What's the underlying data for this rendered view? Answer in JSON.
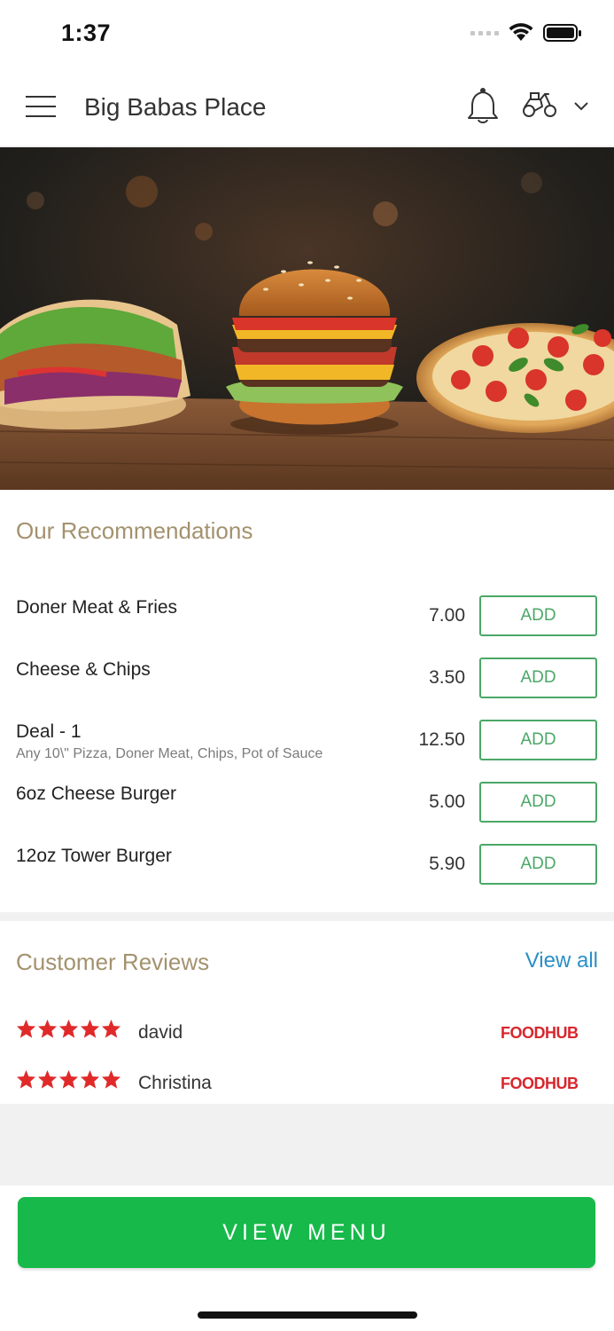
{
  "status_bar": {
    "time": "1:37"
  },
  "header": {
    "title": "Big Babas Place"
  },
  "recommendations": {
    "title": "Our Recommendations",
    "items": [
      {
        "name": "Doner Meat & Fries",
        "description": "",
        "price": "7.00",
        "button": "ADD"
      },
      {
        "name": "Cheese & Chips",
        "description": "",
        "price": "3.50",
        "button": "ADD"
      },
      {
        "name": "Deal - 1",
        "description": "Any 10\\\" Pizza, Doner Meat, Chips, Pot of Sauce",
        "price": "12.50",
        "button": "ADD"
      },
      {
        "name": "6oz Cheese Burger",
        "description": "",
        "price": "5.00",
        "button": "ADD"
      },
      {
        "name": "12oz Tower Burger",
        "description": "",
        "price": "5.90",
        "button": "ADD"
      }
    ]
  },
  "reviews": {
    "title": "Customer Reviews",
    "view_all": "View all",
    "items": [
      {
        "name": "david",
        "rating": 5,
        "source": "FOODHUB"
      },
      {
        "name": "Christina",
        "rating": 5,
        "source": "FOODHUB"
      }
    ]
  },
  "cta": {
    "label": "VIEW MENU"
  },
  "colors": {
    "accent_gold": "#a3926e",
    "add_green": "#4aa867",
    "cta_green": "#17b94a",
    "link_blue": "#2a8fc7",
    "star_red": "#e02a2a",
    "foodhub_red": "#d8262c"
  }
}
